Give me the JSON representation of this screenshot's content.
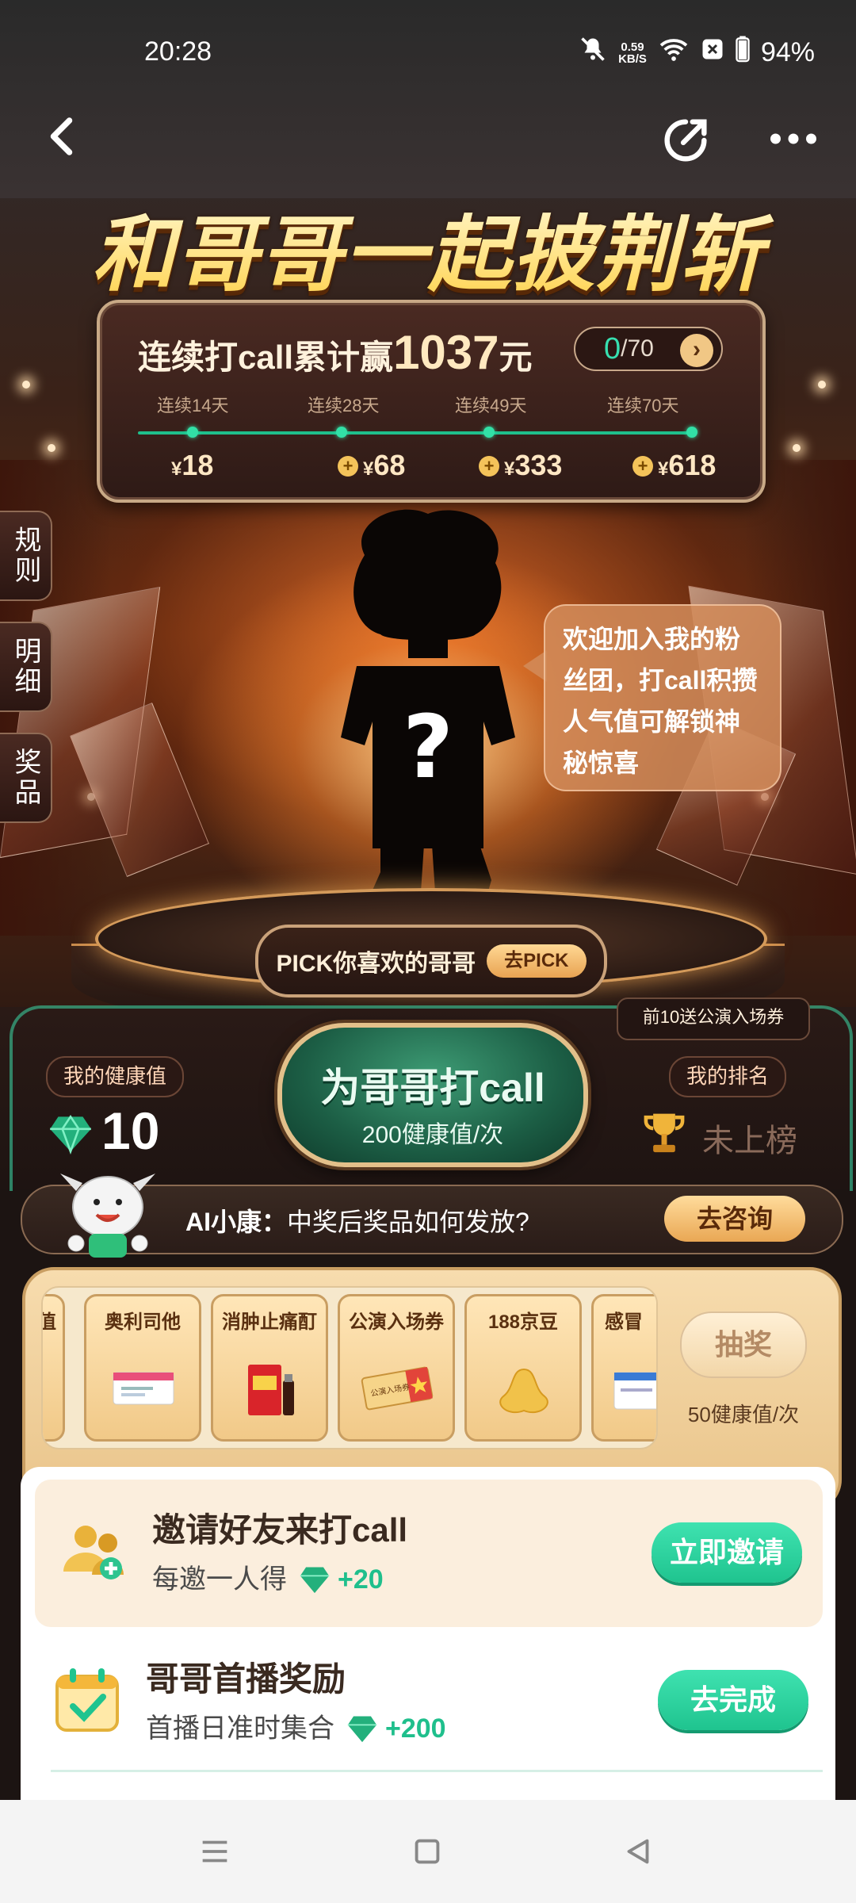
{
  "status_bar": {
    "time": "20:28",
    "net_speed_top": "0.59",
    "net_speed_unit": "KB/S",
    "battery": "94%"
  },
  "hero": {
    "title": "和哥哥一起披荆斩棘"
  },
  "progress": {
    "title_prefix": "连续打call累计赢",
    "amount": "1037",
    "amount_unit": "元",
    "counter_current": "0",
    "counter_total": "/70",
    "milestones": [
      {
        "days": "连续14天",
        "reward_symbol": "¥",
        "reward": "18"
      },
      {
        "days": "连续28天",
        "reward_symbol": "¥",
        "reward": "68"
      },
      {
        "days": "连续49天",
        "reward_symbol": "¥",
        "reward": "333"
      },
      {
        "days": "连续70天",
        "reward_symbol": "¥",
        "reward": "618"
      }
    ]
  },
  "side_tabs": [
    "规则",
    "明细",
    "奖品"
  ],
  "bubble": {
    "text": "欢迎加入我的粉丝团，打call积攒人气值可解锁神秘惊喜"
  },
  "mystery_mark": "?",
  "pick": {
    "label": "PICK你喜欢的哥哥",
    "button": "去PICK"
  },
  "call": {
    "promo_tag": "前10送公演入场券",
    "health_label": "我的健康值",
    "health_value": "10",
    "rank_label": "我的排名",
    "rank_value": "未上榜",
    "button_title": "为哥哥打call",
    "button_sub": "200健康值/次"
  },
  "ai": {
    "name": "AI小康：",
    "question": "中奖后奖品如何发放?",
    "button": "去咨询"
  },
  "lottery": {
    "prizes": [
      "值",
      "奥利司他",
      "消肿止痛酊",
      "公演入场券",
      "188京豆",
      "感冒"
    ],
    "ticket_text": "公演入场券",
    "draw_button": "抽奖",
    "cost": "50健康值/次"
  },
  "tasks": [
    {
      "title": "邀请好友来打call",
      "sub": "每邀一人得",
      "bonus": "+20",
      "button": "立即邀请"
    },
    {
      "title": "哥哥首播奖励",
      "sub": "首播日准时集合",
      "bonus": "+200",
      "button": "去完成"
    }
  ],
  "colors": {
    "accent_green": "#1fc48f",
    "gold": "#ffd35a",
    "brown_dark": "#2a1814"
  }
}
